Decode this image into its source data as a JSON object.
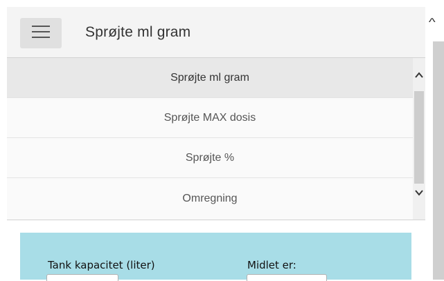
{
  "header": {
    "menu_icon": "hamburger-icon",
    "title": "Sprøjte ml gram"
  },
  "nav": {
    "items": [
      {
        "label": "Sprøjte ml gram",
        "active": true
      },
      {
        "label": "Sprøjte MAX dosis",
        "active": false
      },
      {
        "label": "Sprøjte %",
        "active": false
      },
      {
        "label": "Omregning",
        "active": false
      }
    ]
  },
  "form": {
    "background_color": "#a8dde7",
    "tank_capacity_label": "Tank kapacitet (liter)",
    "tank_capacity_value": "",
    "agent_label": "Midlet er:",
    "agent_value": ""
  },
  "colors": {
    "header_bg": "#f4f4f4",
    "active_item_bg": "#e8e8e8",
    "panel_bg": "#a8dde7"
  }
}
